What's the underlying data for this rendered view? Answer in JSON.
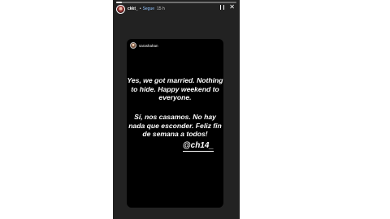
{
  "story": {
    "progress": 0.05,
    "header": {
      "username": "ckkt_",
      "separator": "•",
      "place": "Segue",
      "time": "15 h"
    },
    "shared_post": {
      "username": "sarashahan",
      "text_en": "Yes, we got married. Nothing to hide. Happy weekend to everyone.",
      "text_es": "Sí, nos casamos. No hay nada que esconder. Feliz fin de semana a todos!",
      "mention": "@ch14_"
    }
  }
}
